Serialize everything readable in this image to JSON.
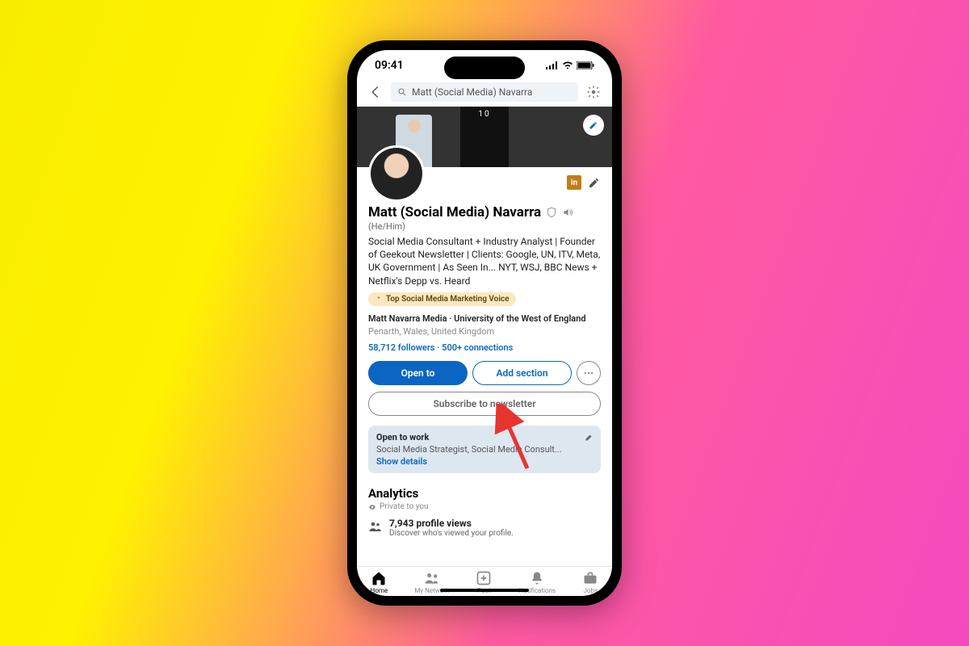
{
  "statusbar": {
    "time": "09:41"
  },
  "search": {
    "value": "Matt (Social Media) Navarra"
  },
  "cover": {
    "door_number": "10"
  },
  "profile": {
    "name": "Matt (Social Media) Navarra",
    "pronoun": "(He/Him)",
    "headline": "Social Media Consultant + Industry Analyst | Founder of Geekout Newsletter | Clients: Google, UN, ITV, Meta, UK Government | As Seen In... NYT, WSJ, BBC News + Netflix's Depp vs. Heard",
    "voice_badge": "Top Social Media Marketing Voice",
    "company_school": "Matt Navarra Media · University of the West of England",
    "location": "Penarth, Wales, United Kingdom",
    "followers": "58,712 followers",
    "connections": "500+ connections"
  },
  "actions": {
    "open_to": "Open to",
    "add_section": "Add section",
    "subscribe": "Subscribe to newsletter"
  },
  "open_card": {
    "title": "Open to work",
    "sub": "Social Media Strategist, Social Media Consult...",
    "show": "Show details"
  },
  "analytics": {
    "title": "Analytics",
    "private": "Private to you",
    "views_num": "7,943 profile views",
    "views_desc": "Discover who's viewed your profile."
  },
  "tabs": {
    "home": "Home",
    "network": "My Network",
    "post": "Post",
    "notifications": "Notifications",
    "jobs": "Jobs"
  }
}
